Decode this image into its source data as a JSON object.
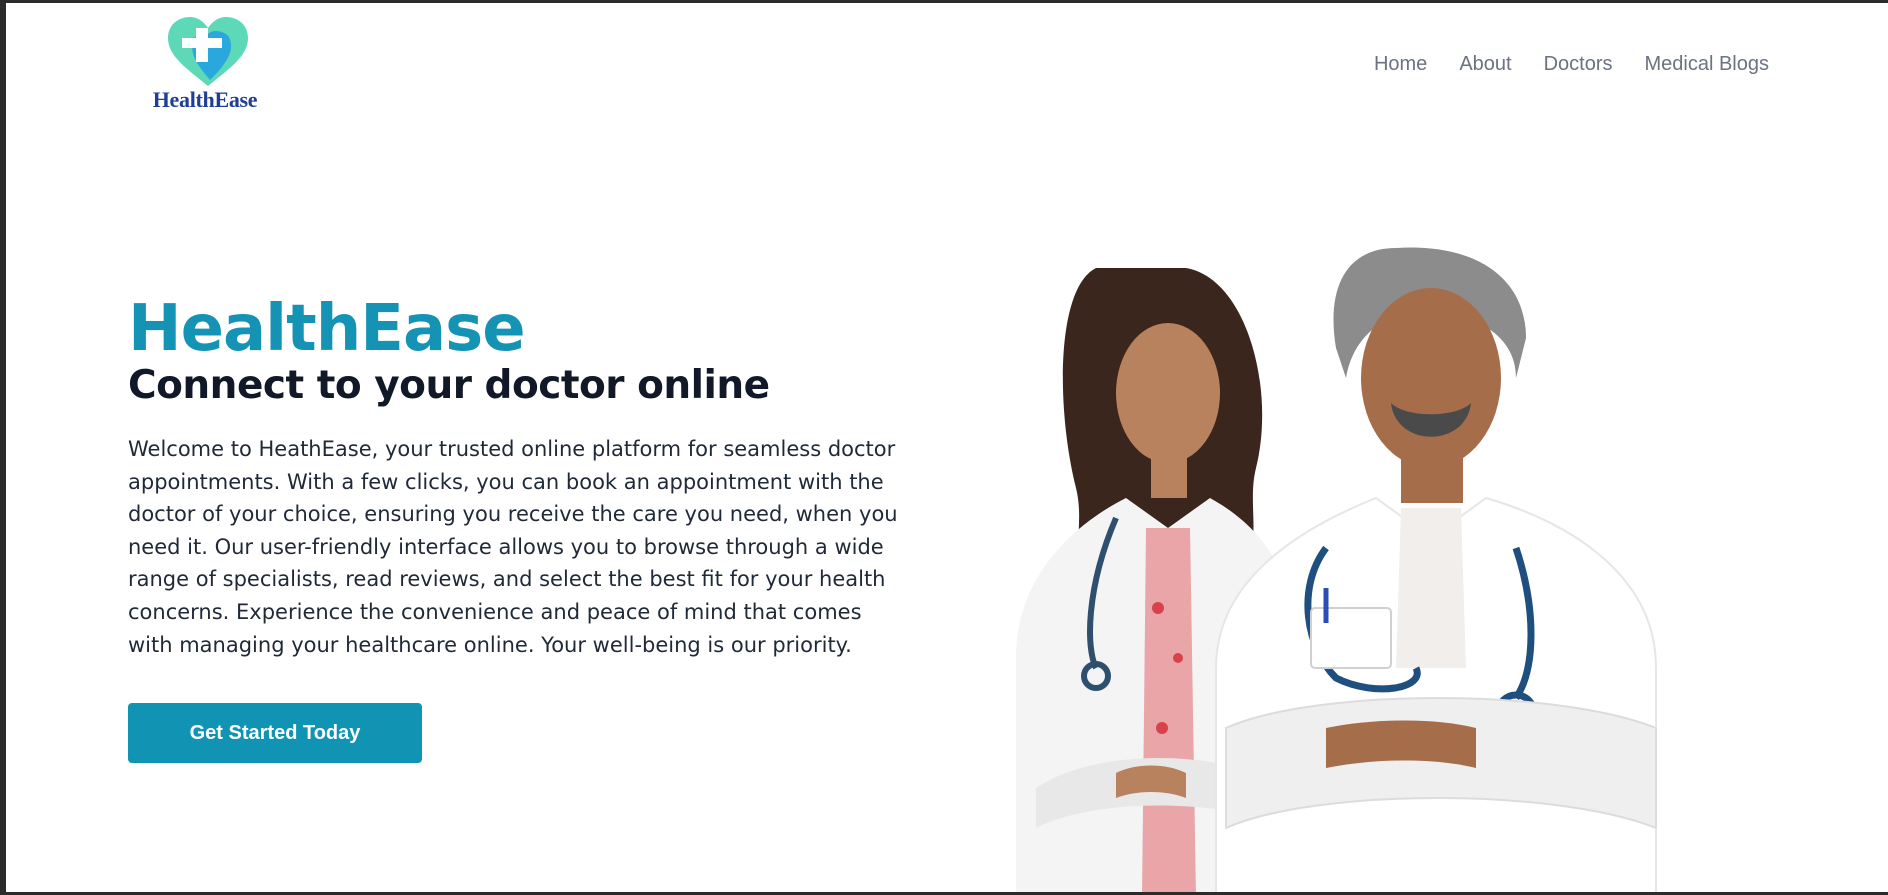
{
  "brand": {
    "name": "HealthEase",
    "colors": {
      "heart_teal": "#5ed9b8",
      "heart_blue": "#2aa8dd",
      "text_navy": "#1f3f95"
    },
    "icon": "heart-cross-logo-icon"
  },
  "nav": {
    "items": [
      {
        "label": "Home"
      },
      {
        "label": "About"
      },
      {
        "label": "Doctors"
      },
      {
        "label": "Medical Blogs"
      }
    ]
  },
  "hero": {
    "title": "HealthEase",
    "subtitle": "Connect to your doctor online",
    "description": "Welcome to HeathEase, your trusted online platform for seamless doctor appointments. With a few clicks, you can book an appointment with the doctor of your choice, ensuring you receive the care you need, when you need it. Our user-friendly interface allows you to browse through a wide range of specialists, read reviews, and select the best fit for your health concerns. Experience the convenience and peace of mind that comes with managing your healthcare online. Your well-being is our priority.",
    "cta_label": "Get Started Today",
    "accent": "#1193b3"
  }
}
